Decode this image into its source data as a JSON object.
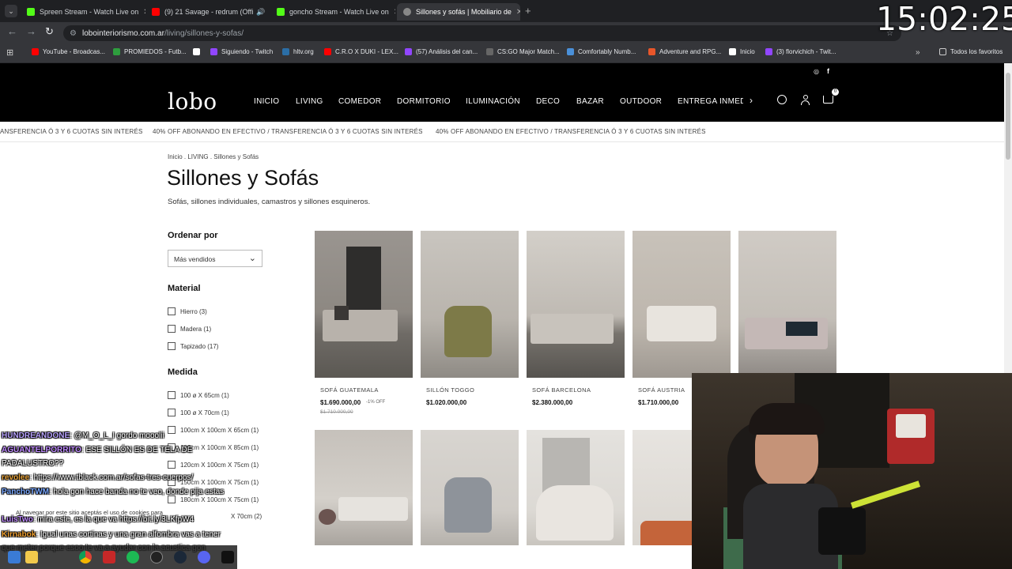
{
  "browser": {
    "tabs": [
      {
        "label": "Spreen Stream - Watch Live on",
        "color": "#53fc18"
      },
      {
        "label": "(9) 21 Savage - redrum (Offi",
        "color": "#ff0000"
      },
      {
        "label": "goncho Stream - Watch Live on",
        "color": "#53fc18"
      },
      {
        "label": "Sillones y sofás | Mobiliario de",
        "color": "#888888"
      }
    ],
    "url_domain": "lobointeriorismo.com.ar",
    "url_path": "/living/sillones-y-sofas/",
    "bookmarks": [
      {
        "label": "YouTube - Broadcas...",
        "color": "#ff0000"
      },
      {
        "label": "PROMIEDOS - Futb...",
        "color": "#2e9e3e"
      },
      {
        "label": "",
        "color": "#ffffff"
      },
      {
        "label": "Siguiendo - Twitch",
        "color": "#9146ff"
      },
      {
        "label": "hltv.org",
        "color": "#2b6ea6"
      },
      {
        "label": "C.R.O X DUKI - LEX...",
        "color": "#ff0000"
      },
      {
        "label": "(57) Análisis del can...",
        "color": "#9146ff"
      },
      {
        "label": "CS:GO Major Match...",
        "color": "#666666"
      },
      {
        "label": "Comfortably Numb...",
        "color": "#4a90d9"
      },
      {
        "label": "Adventure and RPG...",
        "color": "#e8562a"
      },
      {
        "label": "Inicio",
        "color": "#ffffff"
      },
      {
        "label": "(3) florvichich - Twit...",
        "color": "#9146ff"
      }
    ],
    "all_favorites": "Todos los favoritos"
  },
  "site": {
    "logo": "lobo",
    "nav": [
      "INICIO",
      "LIVING",
      "COMEDOR",
      "DORMITORIO",
      "ILUMINACIÓN",
      "DECO",
      "BAZAR",
      "OUTDOOR",
      "ENTREGA INMED"
    ],
    "cart_count": "0",
    "promo": [
      "ANSFERENCIA Ó 3 Y 6 CUOTAS SIN INTERÉS",
      "40% OFF ABONANDO EN EFECTIVO / TRANSFERENCIA Ó 3 Y 6 CUOTAS SIN INTERÉS",
      "40% OFF ABONANDO EN EFECTIVO / TRANSFERENCIA Ó 3 Y 6 CUOTAS SIN INTERÉS"
    ],
    "breadcrumb": [
      "Inicio",
      "LIVING",
      "Sillones y Sofás"
    ],
    "title": "Sillones y Sofás",
    "subtitle": "Sofás, sillones individuales, camastros y sillones esquineros."
  },
  "sidebar": {
    "sort_heading": "Ordenar por",
    "sort_value": "Más vendidos",
    "material_heading": "Material",
    "materials": [
      "Hierro (3)",
      "Madera (1)",
      "Tapizado (17)"
    ],
    "size_heading": "Medida",
    "sizes": [
      "100 ø X 65cm (1)",
      "100 ø X 70cm (1)",
      "100cm X 100cm X 65cm (1)",
      "100cm X 100cm X 85cm (1)",
      "120cm X 100cm X 75cm (1)",
      "150cm X 100cm X 75cm (1)",
      "180cm X 100cm X 75cm (1)",
      "X 70cm (2)"
    ]
  },
  "products": [
    {
      "name": "SOFÁ GUATEMALA",
      "price": "$1.690.000,00",
      "discount": "-1% OFF",
      "old_price": "$1.710.000,00"
    },
    {
      "name": "SILLÓN TOGGO",
      "price": "$1.020.000,00",
      "discount": "",
      "old_price": ""
    },
    {
      "name": "SOFÁ BARCELONA",
      "price": "$2.380.000,00",
      "discount": "",
      "old_price": ""
    },
    {
      "name": "SOFÁ AUSTRIA",
      "price": "$1.710.000,00",
      "discount": "",
      "old_price": ""
    }
  ],
  "overlay": {
    "clock": "15:02:25",
    "cookie": "Al navegar por este sitio aceptás el uso de cookies para",
    "chat": [
      {
        "user": "HUNDREANDONE",
        "color": "#b9a4ff",
        "msg": ": @M_O_L_I gordo mooolii"
      },
      {
        "user": "AGUANTELPORRITO",
        "color": "#c08cff",
        "msg": ": ESE SILLÓN ES DE TELA DE PADALUSTRO??"
      },
      {
        "user": "revolee",
        "color": "#e8a33a",
        "msg": ": https://www.tblack.com.ar/sofas-tres-cuerpos/"
      },
      {
        "user": "PanchoTWM",
        "color": "#7aa8ff",
        "msg": ": hola gon hace banda no te veo, donde pija estas"
      },
      {
        "user": "LuisTwo",
        "color": "#c08cff",
        "msg": ": mira este, es la que va https://bit.ly/3LKfpW4"
      },
      {
        "user": "Kirnabok",
        "color": "#f0a030",
        "msg": ": Igual unas cortinas y una gran alfombra vas a tener que meter porque esoo te va a ayudar con la acustica gon"
      }
    ]
  }
}
